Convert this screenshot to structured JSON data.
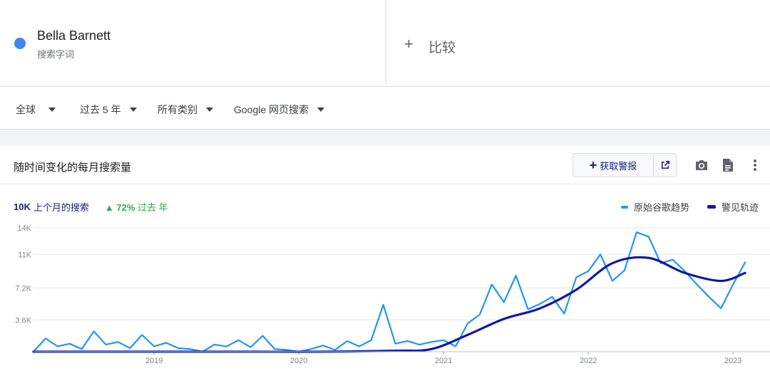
{
  "term": {
    "name": "Bella Barnett",
    "subtitle": "搜索字词",
    "dot_color": "#4285f4"
  },
  "compare": {
    "label": "比较"
  },
  "filters": {
    "region": "全球",
    "time": "过去 5 年",
    "category": "所有类别",
    "property": "Google 网页搜索"
  },
  "chart_header": {
    "title": "随时间变化的每月搜索量",
    "alert_label": "获取警报"
  },
  "stats": {
    "last_month_value": "10K",
    "last_month_label": "上个月的搜索",
    "change_value": "72%",
    "change_label": "过去 年"
  },
  "legend": {
    "raw": "原始谷歌趋势",
    "trend": "警见轨迹"
  },
  "colors": {
    "raw": "#2196f3",
    "trend": "#0d1aa3",
    "accent": "#1a237e",
    "up": "#34a853"
  },
  "chart_data": {
    "type": "line",
    "ylim": [
      0,
      14000
    ],
    "yticks": [
      3600,
      7200,
      11000,
      14000
    ],
    "ytick_labels": [
      "3.6K",
      "7.2K",
      "11K",
      "14K"
    ],
    "xlim": [
      "2018-03",
      "2023-03"
    ],
    "xticks": [
      "2019-01",
      "2020-01",
      "2021-01",
      "2022-01",
      "2023-01"
    ],
    "xtick_labels": [
      "2019",
      "2020",
      "2021",
      "2022",
      "2023"
    ],
    "grid": true,
    "legend_position": "top-right",
    "series": [
      {
        "name": "原始谷歌趋势",
        "x": [
          "2018-03",
          "2018-04",
          "2018-05",
          "2018-06",
          "2018-07",
          "2018-08",
          "2018-09",
          "2018-10",
          "2018-11",
          "2018-12",
          "2019-01",
          "2019-02",
          "2019-03",
          "2019-04",
          "2019-05",
          "2019-06",
          "2019-07",
          "2019-08",
          "2019-09",
          "2019-10",
          "2019-11",
          "2019-12",
          "2020-01",
          "2020-02",
          "2020-03",
          "2020-04",
          "2020-05",
          "2020-06",
          "2020-07",
          "2020-08",
          "2020-09",
          "2020-10",
          "2020-11",
          "2020-12",
          "2021-01",
          "2021-02",
          "2021-03",
          "2021-04",
          "2021-05",
          "2021-06",
          "2021-07",
          "2021-08",
          "2021-09",
          "2021-10",
          "2021-11",
          "2021-12",
          "2022-01",
          "2022-02",
          "2022-03",
          "2022-04",
          "2022-05",
          "2022-06",
          "2022-07",
          "2022-08",
          "2022-09",
          "2022-10",
          "2022-11",
          "2022-12",
          "2023-01",
          "2023-02"
        ],
        "values": [
          0,
          1500,
          600,
          900,
          300,
          2300,
          800,
          1100,
          400,
          1900,
          600,
          1000,
          400,
          300,
          0,
          800,
          600,
          1300,
          500,
          1800,
          300,
          200,
          0,
          300,
          700,
          200,
          1200,
          600,
          1300,
          5300,
          900,
          1200,
          800,
          1100,
          1300,
          600,
          3200,
          4200,
          7600,
          5600,
          8600,
          4800,
          5400,
          6200,
          4300,
          8400,
          9100,
          11000,
          8000,
          9200,
          13500,
          13000,
          10000,
          10400,
          9100,
          7600,
          6200,
          4900,
          7600,
          10100
        ]
      },
      {
        "name": "警见轨迹",
        "x": [
          "2018-03",
          "2018-09",
          "2019-03",
          "2019-09",
          "2020-03",
          "2020-09",
          "2020-12",
          "2021-03",
          "2021-06",
          "2021-09",
          "2021-12",
          "2022-03",
          "2022-06",
          "2022-09",
          "2022-12",
          "2023-02"
        ],
        "values": [
          0,
          0,
          0,
          0,
          0,
          100,
          300,
          1900,
          3700,
          4900,
          7000,
          10000,
          10600,
          8900,
          8000,
          8900
        ]
      }
    ]
  }
}
